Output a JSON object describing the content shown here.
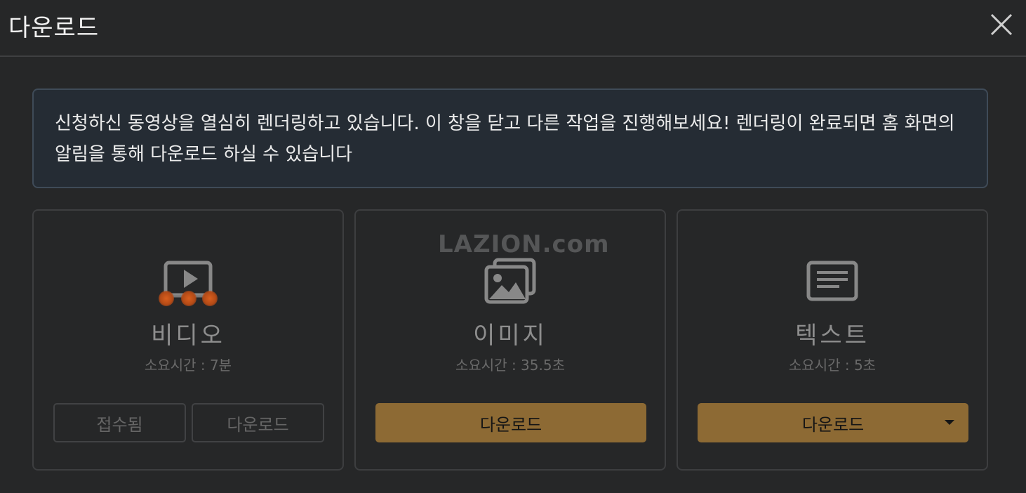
{
  "window": {
    "title": "다운로드",
    "close_icon": "close-icon"
  },
  "notice": {
    "text": "신청하신 동영상을 열심히 렌더링하고 있습니다. 이 창을 닫고 다른 작업을 진행해보세요! 렌더링이 완료되면 홈 화면의 알림을 통해 다운로드 하실 수 있습니다"
  },
  "watermark": "LAZION.com",
  "cards": [
    {
      "icon": "video-play-icon",
      "title": "비디오",
      "time": "소요시간 : 7분",
      "buttons": [
        {
          "label": "접수됨",
          "enabled": false
        },
        {
          "label": "다운로드",
          "enabled": false
        }
      ]
    },
    {
      "icon": "image-gallery-icon",
      "title": "이미지",
      "time": "소요시간 : 35.5초",
      "buttons": [
        {
          "label": "다운로드",
          "enabled": true
        }
      ]
    },
    {
      "icon": "text-document-icon",
      "title": "텍스트",
      "time": "소요시간 : 5초",
      "buttons": [
        {
          "label": "다운로드",
          "enabled": true,
          "has_dropdown": true
        }
      ]
    }
  ],
  "colors": {
    "background": "#262728",
    "accent": "#8d6a34",
    "notice_bg": "#252c34",
    "progress_dots": "#d85f1e"
  }
}
